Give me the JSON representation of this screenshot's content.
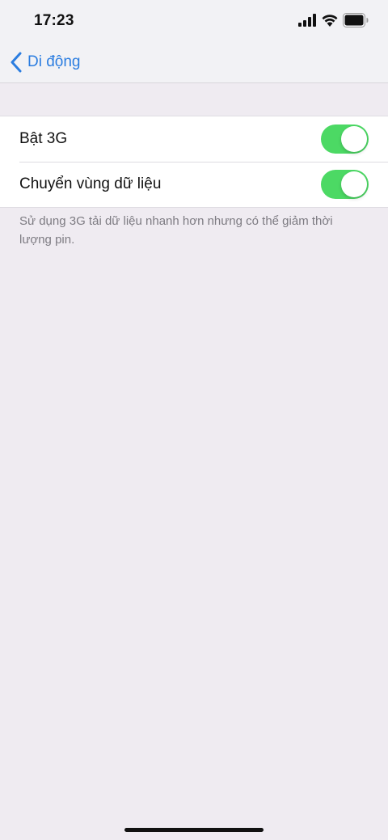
{
  "status_bar": {
    "time": "17:23",
    "icons": [
      "signal-icon",
      "wifi-icon",
      "battery-icon"
    ]
  },
  "nav": {
    "back_label": "Di động",
    "back_icon": "chevron-left-icon"
  },
  "settings": {
    "rows": [
      {
        "label": "Bật 3G",
        "toggle_on": true
      },
      {
        "label": "Chuyển vùng dữ liệu",
        "toggle_on": true
      }
    ],
    "footer_note": "Sử dụng 3G tải dữ liệu nhanh hơn nhưng có thể giảm thời lượng pin."
  },
  "colors": {
    "accent": "#2b7de0",
    "toggle_on": "#4cd964",
    "background": "#efebf1"
  }
}
